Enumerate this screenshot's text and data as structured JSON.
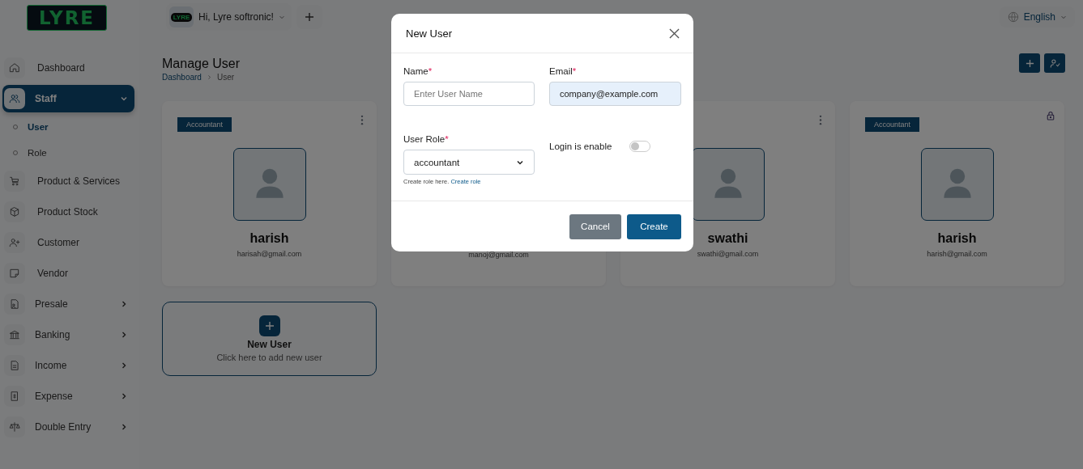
{
  "logo": {
    "text": "LYRE"
  },
  "topbar": {
    "greeting": "Hi, Lyre softronic!",
    "avatar_text": "LYRE",
    "language": "English"
  },
  "sidebar": {
    "items": [
      {
        "label": "Dashboard",
        "kind": "link",
        "selected": false
      },
      {
        "label": "Staff",
        "kind": "group",
        "selected": true,
        "expanded": true,
        "children": [
          {
            "label": "User",
            "selected": true
          },
          {
            "label": "Role",
            "selected": false
          }
        ]
      },
      {
        "label": "Product & Services",
        "kind": "link",
        "selected": false
      },
      {
        "label": "Product Stock",
        "kind": "link",
        "selected": false
      },
      {
        "label": "Customer",
        "kind": "link",
        "selected": false
      },
      {
        "label": "Vendor",
        "kind": "link",
        "selected": false
      },
      {
        "label": "Presale",
        "kind": "group",
        "selected": false,
        "expanded": false
      },
      {
        "label": "Banking",
        "kind": "group",
        "selected": false,
        "expanded": false
      },
      {
        "label": "Income",
        "kind": "group",
        "selected": false,
        "expanded": false
      },
      {
        "label": "Expense",
        "kind": "group",
        "selected": false,
        "expanded": false
      },
      {
        "label": "Double Entry",
        "kind": "group",
        "selected": false,
        "expanded": false
      }
    ]
  },
  "page": {
    "title": "Manage User",
    "breadcrumb": [
      "Dashboard",
      "User"
    ]
  },
  "cards": [
    {
      "badge": "Accountant",
      "name": "harish",
      "email": "harisah@gmail.com",
      "kind": "menu"
    },
    {
      "email": "manoj@gmail.com"
    },
    {
      "name": "swathi",
      "email": "swathi@gmail.com",
      "kind": "menu"
    },
    {
      "badge": "Accountant",
      "name": "harish",
      "email": "harish@gmail.com",
      "kind": "lock"
    }
  ],
  "new_user_card": {
    "title": "New User",
    "subtitle": "Click here to add new user"
  },
  "modal": {
    "title": "New User",
    "name": {
      "label": "Name",
      "required_mark": "*",
      "placeholder": "Enter User Name"
    },
    "email": {
      "label": "Email",
      "required_mark": "*",
      "value": "company@example.com"
    },
    "role": {
      "label": "User Role",
      "required_mark": "*",
      "value": "accountant",
      "help": "Create role here.",
      "help_link": "Create role"
    },
    "login": {
      "label": "Login is enable",
      "on": false
    },
    "buttons": [
      {
        "label": "Cancel",
        "kind": "secondary"
      },
      {
        "label": "Create",
        "kind": "primary"
      }
    ]
  }
}
